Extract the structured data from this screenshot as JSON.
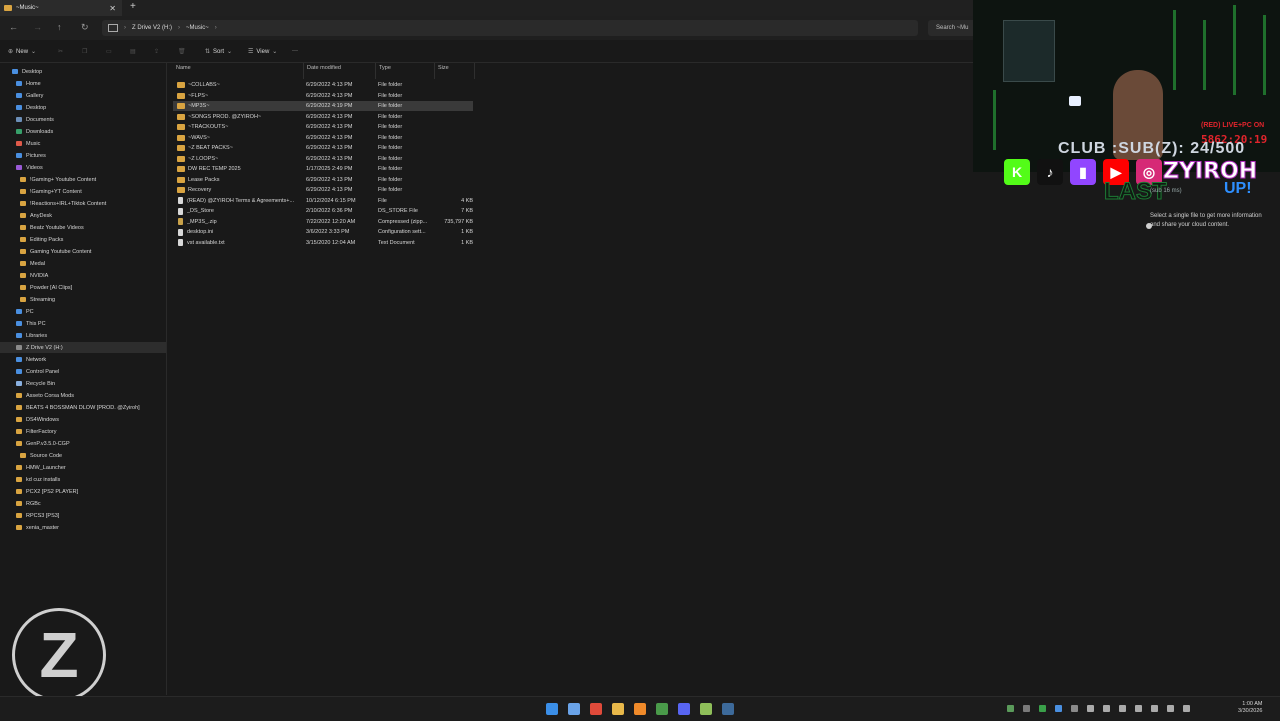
{
  "window": {
    "tab_title": "~Music~",
    "close_glyph": "✕",
    "new_tab_glyph": "+"
  },
  "address": {
    "crumbs": [
      "Z Drive V2 (H:)",
      "~Music~"
    ],
    "search_placeholder": "Search ~Mu"
  },
  "toolbar": {
    "new_label": "New",
    "sort_label": "Sort",
    "view_label": "View",
    "more_glyph": "···"
  },
  "sidebar": {
    "items": [
      {
        "label": "Desktop",
        "color": "#4a8fe0"
      },
      {
        "label": "Home",
        "color": "#4a8fe0"
      },
      {
        "label": "Gallery",
        "color": "#4a8fe0"
      },
      {
        "label": "Desktop",
        "color": "#4a8fe0"
      },
      {
        "label": "Documents",
        "color": "#6c8fb8"
      },
      {
        "label": "Downloads",
        "color": "#37a06a"
      },
      {
        "label": "Music",
        "color": "#e05a4a"
      },
      {
        "label": "Pictures",
        "color": "#4a8fe0"
      },
      {
        "label": "Videos",
        "color": "#9a5ad6"
      },
      {
        "label": "!Gaming+ Youtube Content",
        "color": "#d9a441"
      },
      {
        "label": "!Gaming+YT Content",
        "color": "#d9a441"
      },
      {
        "label": "!Reactions+IRL+Tiktok Content",
        "color": "#d9a441"
      },
      {
        "label": "AnyDesk",
        "color": "#d9a441"
      },
      {
        "label": "Beatz Youtube Videos",
        "color": "#d9a441"
      },
      {
        "label": "Editing Packs",
        "color": "#d9a441"
      },
      {
        "label": "Gaming Youtube Content",
        "color": "#d9a441"
      },
      {
        "label": "Medal",
        "color": "#d9a441"
      },
      {
        "label": "NVIDIA",
        "color": "#d9a441"
      },
      {
        "label": "Powder [AI Clips]",
        "color": "#d9a441"
      },
      {
        "label": "Streaming",
        "color": "#d9a441"
      },
      {
        "label": "PC",
        "color": "#4a8fe0"
      },
      {
        "label": "This PC",
        "color": "#4a8fe0"
      },
      {
        "label": "Libraries",
        "color": "#4a8fe0"
      },
      {
        "label": "Z Drive V2 (H:)",
        "color": "#8a8a8a"
      },
      {
        "label": "Network",
        "color": "#4a8fe0"
      },
      {
        "label": "Control Panel",
        "color": "#4a8fe0"
      },
      {
        "label": "Recycle Bin",
        "color": "#8ab0e0"
      },
      {
        "label": "Asseto Corsa Mods",
        "color": "#d9a441"
      },
      {
        "label": "BEATS 4 BOSSMAN DLOW [PROD. @Zyiroh]",
        "color": "#d9a441"
      },
      {
        "label": "DS4Windows",
        "color": "#d9a441"
      },
      {
        "label": "FilterFactory",
        "color": "#d9a441"
      },
      {
        "label": "GenP.v3.5.0-CGP",
        "color": "#d9a441"
      },
      {
        "label": "Source Code",
        "color": "#d9a441"
      },
      {
        "label": "HMW_Launcher",
        "color": "#d9a441"
      },
      {
        "label": "kd cuz installs",
        "color": "#d9a441"
      },
      {
        "label": "PCX2 [PS2 PLAYER]",
        "color": "#d9a441"
      },
      {
        "label": "RGBc",
        "color": "#d9a441"
      },
      {
        "label": "RPCS3 [PS3]",
        "color": "#d9a441"
      },
      {
        "label": "xenia_master",
        "color": "#d9a441"
      }
    ]
  },
  "columns": {
    "name": "Name",
    "date": "Date modified",
    "type": "Type",
    "size": "Size"
  },
  "files": [
    {
      "name": "~COLLABS~",
      "date": "6/29/2022 4:13 PM",
      "type": "File folder",
      "size": "",
      "kind": "folder"
    },
    {
      "name": "~FLPS~",
      "date": "6/29/2022 4:13 PM",
      "type": "File folder",
      "size": "",
      "kind": "folder"
    },
    {
      "name": "~MP3S~",
      "date": "6/29/2022 4:19 PM",
      "type": "File folder",
      "size": "",
      "kind": "folder",
      "selected": true
    },
    {
      "name": "~SONGS PROD. @ZYIROH~",
      "date": "6/29/2022 4:13 PM",
      "type": "File folder",
      "size": "",
      "kind": "folder"
    },
    {
      "name": "~TRACKOUTS~",
      "date": "6/29/2022 4:13 PM",
      "type": "File folder",
      "size": "",
      "kind": "folder"
    },
    {
      "name": "~WAVS~",
      "date": "6/29/2022 4:13 PM",
      "type": "File folder",
      "size": "",
      "kind": "folder"
    },
    {
      "name": "~Z BEAT PACKS~",
      "date": "6/29/2022 4:13 PM",
      "type": "File folder",
      "size": "",
      "kind": "folder"
    },
    {
      "name": "~Z LOOPS~",
      "date": "6/29/2022 4:13 PM",
      "type": "File folder",
      "size": "",
      "kind": "folder"
    },
    {
      "name": "DW REC TEMP 2025",
      "date": "1/17/2025 2:49 PM",
      "type": "File folder",
      "size": "",
      "kind": "folder"
    },
    {
      "name": "Lease Packs",
      "date": "6/29/2022 4:13 PM",
      "type": "File folder",
      "size": "",
      "kind": "folder"
    },
    {
      "name": "Recovery",
      "date": "6/29/2022 4:13 PM",
      "type": "File folder",
      "size": "",
      "kind": "folder"
    },
    {
      "name": "(READ) @ZYIROH Terms & Agreements+...",
      "date": "10/12/2024 6:15 PM",
      "type": "File",
      "size": "4 KB",
      "kind": "file"
    },
    {
      "name": "_DS_Store",
      "date": "2/10/2022 6:36 PM",
      "type": "DS_STORE File",
      "size": "7 KB",
      "kind": "file"
    },
    {
      "name": "_MP3S_.zip",
      "date": "7/22/2022 12:20 AM",
      "type": "Compressed (zipp...",
      "size": "735,797 KB",
      "kind": "zip"
    },
    {
      "name": "desktop.ini",
      "date": "3/6/2022 3:33 PM",
      "type": "Configuration sett...",
      "size": "1 KB",
      "kind": "file"
    },
    {
      "name": "vst available.txt",
      "date": "3/15/2020 12:04 AM",
      "type": "Text Document",
      "size": "1 KB",
      "kind": "file"
    }
  ],
  "overlay": {
    "live_text": "(RED) LIVE+PC ON",
    "timer": "5862:20:19",
    "club_text": "CLUB :SUB(Z): 24/500",
    "handle": "ZYIROH",
    "last_text": "LAST",
    "up_text": "UP!",
    "sub_small": "(sub  16  ms)",
    "social": [
      {
        "letter": "K",
        "color": "#53fc18",
        "icon": "kick-icon"
      },
      {
        "letter": "♪",
        "color": "#111111",
        "icon": "tiktok-icon"
      },
      {
        "letter": "▮",
        "color": "#9146ff",
        "icon": "twitch-icon"
      },
      {
        "letter": "▶",
        "color": "#ff0000",
        "icon": "youtube-icon"
      },
      {
        "letter": "◎",
        "color": "#d62976",
        "icon": "instagram-icon"
      }
    ],
    "logo_letter": "Z"
  },
  "preview_pane": {
    "message": "Select a single file to get more information and share your cloud content."
  },
  "taskbar": {
    "apps": [
      {
        "name": "start-icon",
        "color": "#3b8fe8"
      },
      {
        "name": "task-view-icon",
        "color": "#6aa3e8"
      },
      {
        "name": "chrome-icon",
        "color": "#e04a3a"
      },
      {
        "name": "file-explorer-icon",
        "color": "#e8b84a"
      },
      {
        "name": "fl-studio-icon",
        "color": "#f08a2a"
      },
      {
        "name": "chrome-profile-icon",
        "color": "#4a9a4a"
      },
      {
        "name": "discord-icon",
        "color": "#5865f2"
      },
      {
        "name": "notepad-icon",
        "color": "#8fbf5a"
      },
      {
        "name": "steam-icon",
        "color": "#3d6a9a"
      }
    ],
    "tray": [
      "#5a9a5a",
      "#7a7a7a",
      "#3aa04a",
      "#4a8fe0",
      "#8a8a8a",
      "#aaaaaa",
      "#aaaaaa",
      "#aaaaaa",
      "#aaaaaa",
      "#aaaaaa",
      "#aaaaaa",
      "#aaaaaa"
    ],
    "time": "1:00 AM",
    "date": "3/30/2026"
  }
}
